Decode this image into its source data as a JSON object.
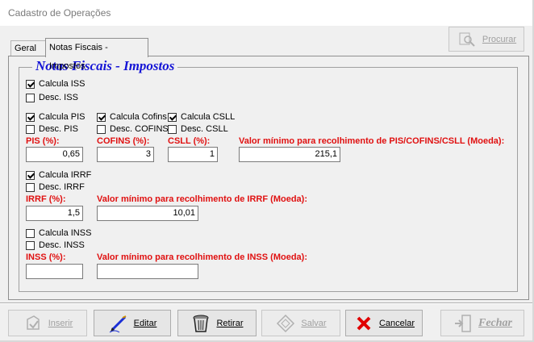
{
  "window": {
    "title": "Cadastro de Operações"
  },
  "tabs": [
    {
      "label": "Geral"
    },
    {
      "label": "Notas Fiscais - Impostos"
    }
  ],
  "top_button": {
    "label": "Procurar"
  },
  "group": {
    "title": "Notas Fiscais - Impostos"
  },
  "iss": {
    "calc": "Calcula ISS",
    "desc": "Desc. ISS"
  },
  "pis": {
    "calc": "Calcula PIS",
    "desc": "Desc. PIS",
    "label": "PIS (%):",
    "value": "0,65"
  },
  "cofins": {
    "calc": "Calcula Cofins",
    "desc": "Desc. COFINS",
    "label": "COFINS (%):",
    "value": "3"
  },
  "csll": {
    "calc": "Calcula CSLL",
    "desc": "Desc. CSLL",
    "label": "CSLL (%):",
    "value": "1"
  },
  "pcc_min": {
    "label": "Valor mínimo para recolhimento de PIS/COFINS/CSLL (Moeda):",
    "value": "215,1"
  },
  "irrf": {
    "calc": "Calcula IRRF",
    "desc": "Desc. IRRF",
    "label": "IRRF (%):",
    "value": "1,5",
    "min_label": "Valor mínimo para recolhimento de IRRF (Moeda):",
    "min_value": "10,01"
  },
  "inss": {
    "calc": "Calcula INSS",
    "desc": "Desc. INSS",
    "label": "INSS (%):",
    "value": "",
    "min_label": "Valor mínimo para recolhimento de INSS (Moeda):",
    "min_value": ""
  },
  "checks": {
    "iss": true,
    "iss_desc": false,
    "pis": true,
    "pis_desc": false,
    "cofins": true,
    "cofins_desc": false,
    "csll": true,
    "csll_desc": false,
    "irrf": true,
    "irrf_desc": false,
    "inss": false,
    "inss_desc": false
  },
  "buttons": {
    "inserir": "Inserir",
    "editar": "Editar",
    "retirar": "Retirar",
    "salvar": "Salvar",
    "cancelar": "Cancelar",
    "fechar": "Fechar"
  },
  "colors": {
    "group_title": "#1515d6",
    "field_label": "#e01010",
    "cancel_icon": "#e00000"
  }
}
